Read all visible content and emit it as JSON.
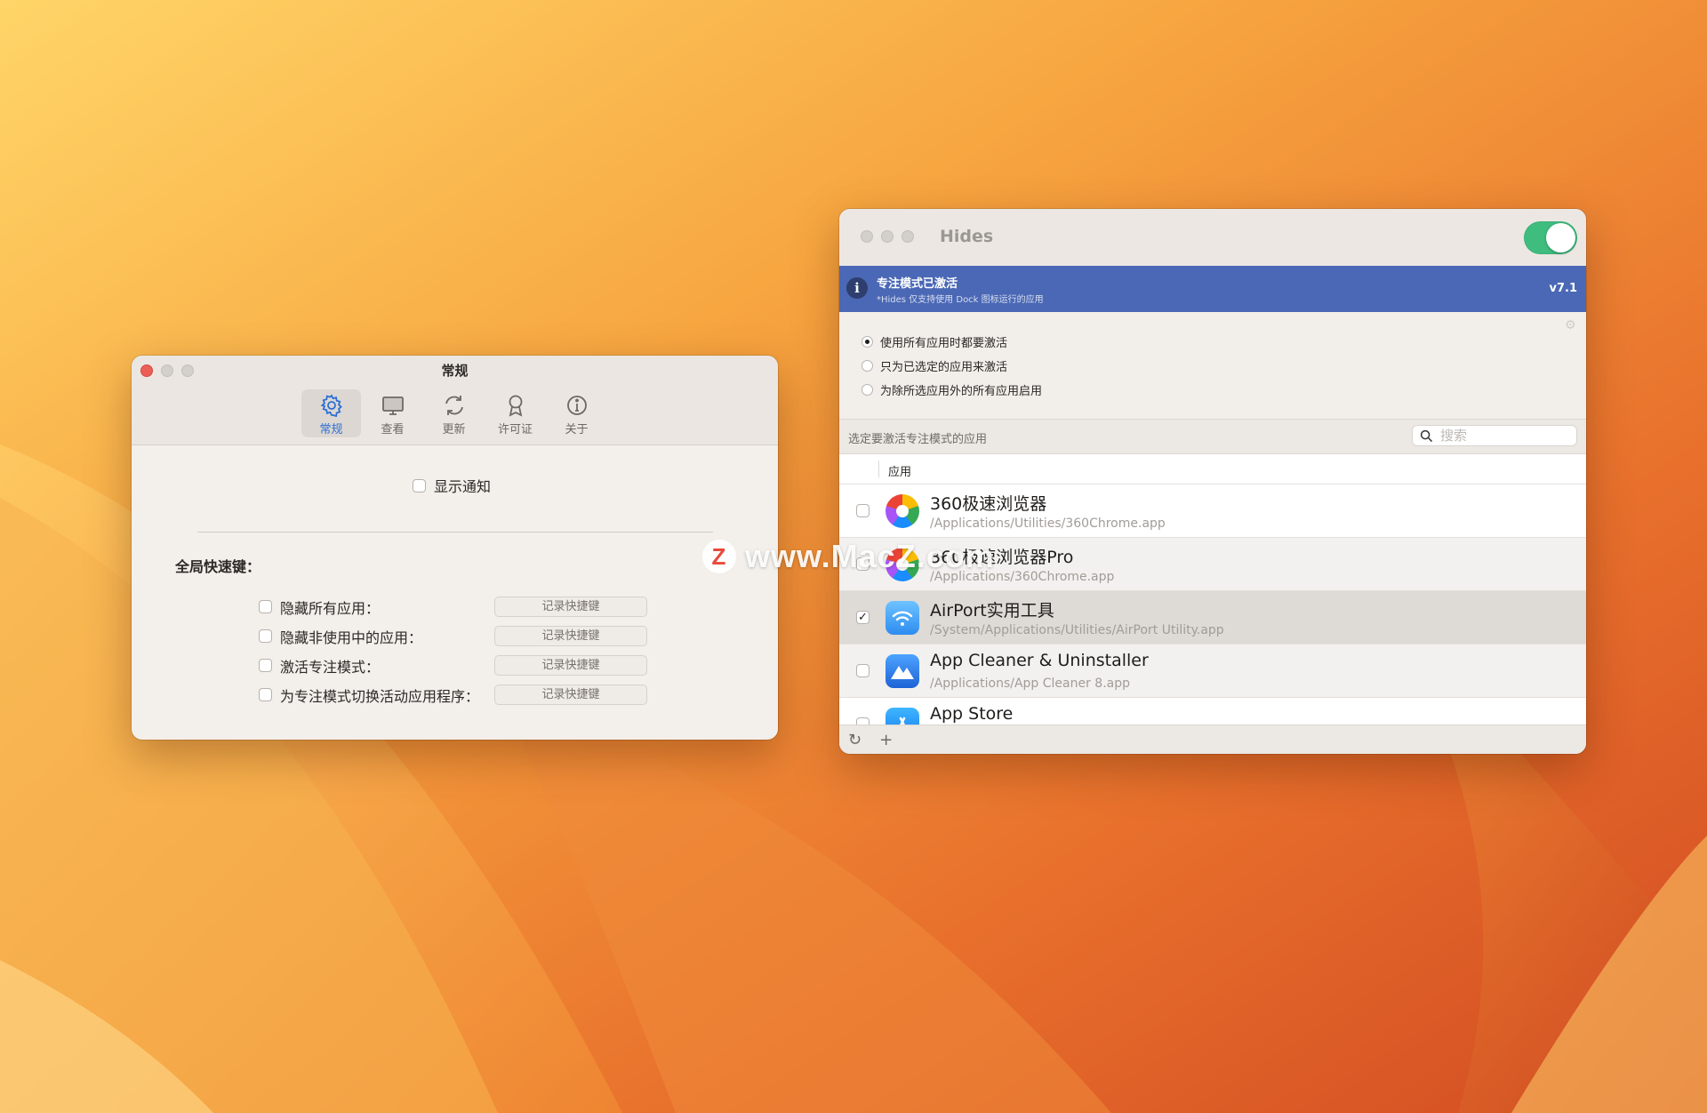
{
  "watermark": {
    "logo": "Z",
    "text": "www.MacZ.com"
  },
  "prefs": {
    "title": "常规",
    "toolbar": [
      {
        "label": "常规",
        "icon": "gear-icon",
        "active": true
      },
      {
        "label": "查看",
        "icon": "monitor-icon",
        "active": false
      },
      {
        "label": "更新",
        "icon": "refresh-icon",
        "active": false
      },
      {
        "label": "许可证",
        "icon": "ribbon-icon",
        "active": false
      },
      {
        "label": "关于",
        "icon": "info-icon",
        "active": false
      }
    ],
    "show_notification": {
      "label": "显示通知",
      "checked": false
    },
    "hotkey_heading": "全局快速键：",
    "hotkeys": [
      {
        "label": "隐藏所有应用：",
        "button": "记录快捷键",
        "checked": false
      },
      {
        "label": "隐藏非使用中的应用：",
        "button": "记录快捷键",
        "checked": false
      },
      {
        "label": "激活专注模式：",
        "button": "记录快捷键",
        "checked": false
      },
      {
        "label": "为专注模式切换活动应用程序：",
        "button": "记录快捷键",
        "checked": false
      }
    ]
  },
  "hides": {
    "title": "Hides",
    "toggle_on": true,
    "accent_color": "#3fbd7f",
    "banner": {
      "title": "专注模式已激活",
      "subtitle": "*Hides 仅支持使用 Dock 图标运行的应用",
      "version": "v7.1",
      "icon_glyph": "i",
      "color": "#4a68b5"
    },
    "modes": [
      {
        "label": "使用所有应用时都要激活",
        "selected": true
      },
      {
        "label": "只为已选定的应用来激活",
        "selected": false
      },
      {
        "label": "为除所选应用外的所有应用启用",
        "selected": false
      }
    ],
    "filter_label": "选定要激活专注模式的应用",
    "search_placeholder": "搜索",
    "column_header": "应用",
    "apps": [
      {
        "name": "360极速浏览器",
        "path": "/Applications/Utilities/360Chrome.app",
        "checked": false,
        "icon": "360-browser-icon"
      },
      {
        "name": "360极速浏览器Pro",
        "path": "/Applications/360Chrome.app",
        "checked": false,
        "icon": "360-browser-pro-icon"
      },
      {
        "name": "AirPort实用工具",
        "path": "/System/Applications/Utilities/AirPort Utility.app",
        "checked": true,
        "icon": "airport-utility-icon"
      },
      {
        "name": "App Cleaner & Uninstaller",
        "path": "/Applications/App Cleaner 8.app",
        "checked": false,
        "icon": "app-cleaner-icon"
      },
      {
        "name": "App Store",
        "path": "",
        "checked": false,
        "icon": "app-store-icon"
      }
    ],
    "bottom": {
      "refresh_glyph": "↻",
      "add_glyph": "+"
    }
  }
}
